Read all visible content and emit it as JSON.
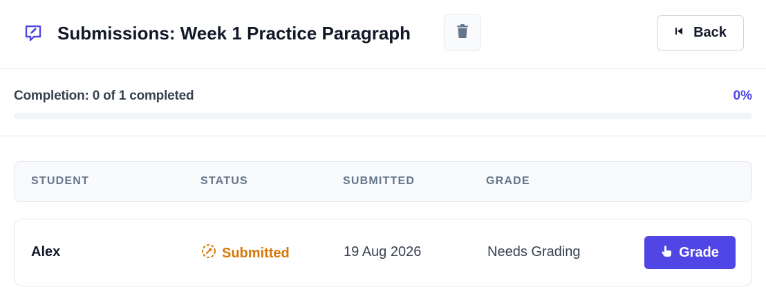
{
  "header": {
    "title": "Submissions: Week 1 Practice Paragraph",
    "title_icon": "edit-note-icon",
    "delete_icon": "trash-icon",
    "back_label": "Back",
    "back_icon": "skip-back-icon"
  },
  "progress": {
    "label": "Completion: 0 of 1 completed",
    "percent_label": "0%",
    "fraction": 0
  },
  "table": {
    "columns": [
      "STUDENT",
      "STATUS",
      "SUBMITTED",
      "GRADE"
    ],
    "rows": [
      {
        "student": "Alex",
        "status": "Submitted",
        "status_icon": "clock-dashed-icon",
        "submitted": "19 Aug 2026",
        "grade": "Needs Grading",
        "action_label": "Grade",
        "action_icon": "pointer-hand-icon"
      }
    ]
  },
  "colors": {
    "accent": "#4f46e5",
    "status_submitted": "#d97706",
    "muted": "#64748b"
  }
}
